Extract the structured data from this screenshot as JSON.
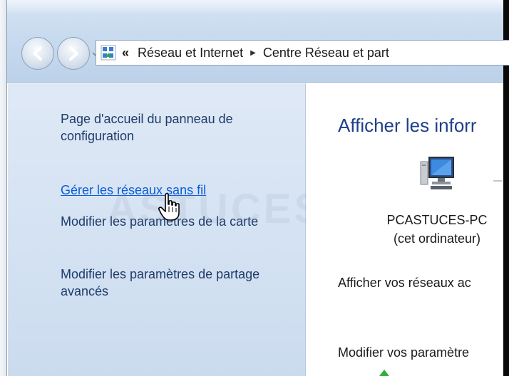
{
  "addressbar": {
    "overflow": "«",
    "breadcrumbs": [
      "Réseau et Internet",
      "Centre Réseau et part"
    ]
  },
  "sidebar": {
    "items": [
      {
        "label": "Page d'accueil du panneau de configuration"
      },
      {
        "label": "Gérer les réseaux sans fil"
      },
      {
        "label": "Modifier les paramètres de la carte"
      },
      {
        "label": "Modifier les paramètres de partage avancés"
      }
    ]
  },
  "main": {
    "title": "Afficher les inforr",
    "computer_name": "PCASTUCES-PC",
    "computer_sub": "(cet ordinateur)",
    "networks_text": "Afficher vos réseaux ac",
    "modify_text": "Modifier vos paramètre"
  },
  "watermark": "ASTUCES"
}
